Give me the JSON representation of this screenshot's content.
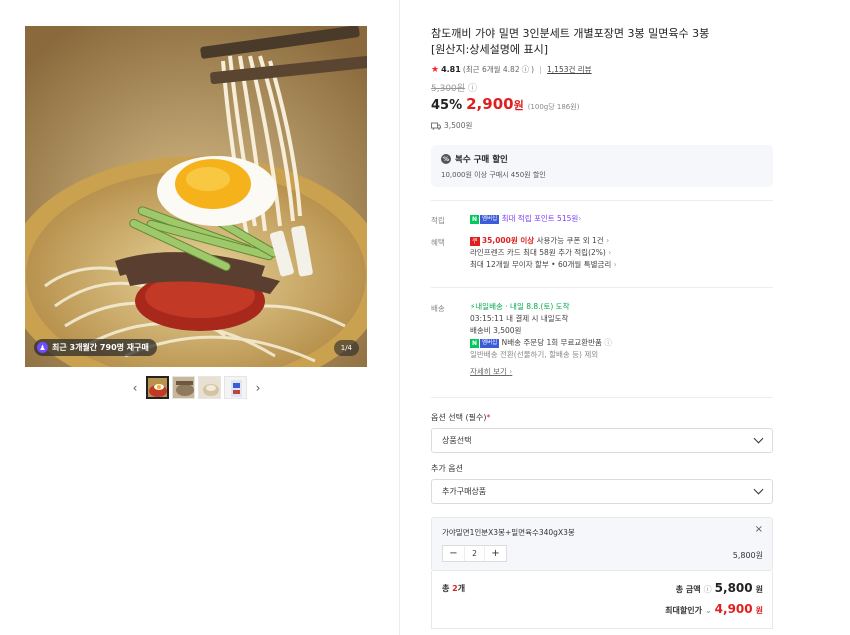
{
  "gallery": {
    "buyer_badge": "최근 3개월간 790명 재구매",
    "counter": "1/4",
    "prev_arrow": "‹",
    "next_arrow": "›"
  },
  "product": {
    "title_line1": "참도깨비 가야 밀면 3인분세트 개별포장면 3봉 밀면육수 3봉",
    "title_line2": "[원산지:상세설명에 표시]",
    "rating_star": "★",
    "rating": "4.81",
    "rating_recent": "(최근 6개월 4.82",
    "rating_recent_close": ")",
    "reviews": "1,153건 리뷰",
    "original_price": "5,300원",
    "discount": "45%",
    "price": "2,900",
    "price_unit": "원",
    "unit_price": "(100g당 186원)",
    "shipping_fee": "3,500원"
  },
  "bulk": {
    "title": "복수 구매 할인",
    "desc": "10,000원 이상 구매시 450원 할인"
  },
  "benefits": {
    "point_label": "적립",
    "point_text": "최대 적립 포인트 515원",
    "benefit_label": "혜택",
    "benefit_line1_red": "35,000원 이상",
    "benefit_line1_rest": " 사용가능 쿠폰 외 1건",
    "benefit_line2": "라인프렌즈 카드 최대 58원 추가 적립(2%)",
    "benefit_line3": "최대 12개월 무이자 할부 • 60개월 특별금리",
    "coupon_tag": "쿠",
    "npay_n": "N",
    "npay_m": "멤버십"
  },
  "delivery": {
    "label": "배송",
    "line1_green": "내일배송",
    "line1_rest": " · 내일 8.8.(토) 도착",
    "line2": "03:15:11  내 결제 시 내일도착",
    "line3": "배송비 3,500원",
    "line4": "N배송 주문당 1회 무료교환반품",
    "line5": "일반배송 전환(선물하기, 할배송 등) 제외",
    "more": "자세히 보기"
  },
  "options": {
    "required_label": "옵션 선택 (필수)",
    "required_mark": "*",
    "required_value": "상품선택",
    "extra_label": "추가 옵션",
    "extra_value": "추가구매상품"
  },
  "selected": {
    "name": "가야밀면1인분X3봉+밀면육수340gX3봉",
    "close": "×",
    "minus": "−",
    "qty": "2",
    "plus": "+",
    "amount": "5,800원"
  },
  "total": {
    "count_prefix": "총 ",
    "count": "2",
    "count_suffix": "개",
    "sum_label": "총 금액",
    "sum_value": "5,800",
    "sum_unit": "원",
    "best_label": "최대할인가",
    "best_value": "4,900",
    "best_unit": "원"
  }
}
